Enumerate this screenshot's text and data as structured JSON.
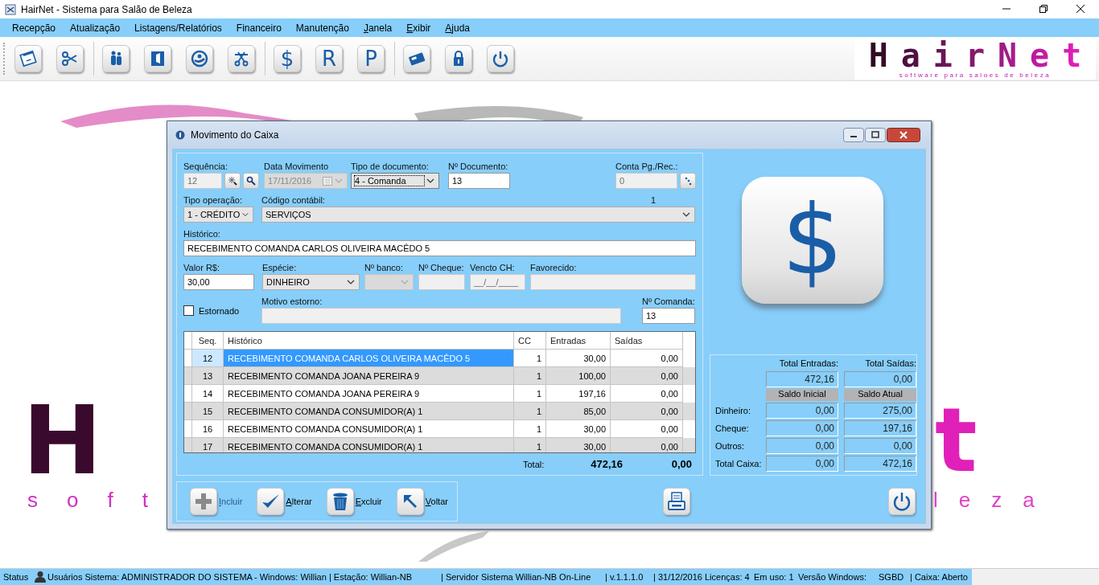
{
  "app": {
    "title": "HairNet - Sistema para Salão de Beleza"
  },
  "menu": [
    {
      "label": "Recepção",
      "mnemonic": false
    },
    {
      "label": "Atualização",
      "mnemonic": false
    },
    {
      "label": "Listagens/Relatórios",
      "mnemonic": false
    },
    {
      "label": "Financeiro",
      "mnemonic": false
    },
    {
      "label": "Manutenção",
      "mnemonic": false
    },
    {
      "label": "Janela",
      "mnemonic": true
    },
    {
      "label": "Exibir",
      "mnemonic": true
    },
    {
      "label": "Ajuda",
      "mnemonic": true
    }
  ],
  "toolbar": [
    [
      {
        "kind": "icon"
      },
      {
        "kind": "icon"
      }
    ],
    [
      {
        "kind": "icon"
      },
      {
        "kind": "icon"
      },
      {
        "kind": "icon"
      },
      {
        "kind": "icon"
      }
    ],
    [
      {
        "kind": "glyph",
        "glyph": "$"
      },
      {
        "kind": "glyph",
        "glyph": "R"
      },
      {
        "kind": "glyph",
        "glyph": "P"
      }
    ],
    [
      {
        "kind": "icon"
      },
      {
        "kind": "icon"
      },
      {
        "kind": "icon"
      }
    ]
  ],
  "logo": {
    "name": "HairNet",
    "tagline": "software para saloes de beleza"
  },
  "background_logo": {
    "letter_left": "H",
    "letter_right": "t",
    "tagline_left": "soft",
    "tagline_right": "leza"
  },
  "dialog": {
    "title": "Movimento do Caixa",
    "rows": [
      [
        {
          "kind": "text",
          "label": "Sequência:",
          "value": "12",
          "disabled": true
        },
        {
          "kind": "date",
          "label": "Data Movimento",
          "value": "17/11/2016",
          "disabled": true
        },
        {
          "kind": "combo",
          "label": "Tipo de documento:",
          "value": "4 - Comanda",
          "disabled": false,
          "focused": true
        },
        {
          "kind": "text",
          "label": "Nº Documento:",
          "value": "13",
          "disabled": false
        },
        {
          "kind": "spacer"
        },
        {
          "kind": "text",
          "label": "Conta Pg./Rec.:",
          "value": "0",
          "disabled": true
        }
      ],
      [
        {
          "kind": "combo",
          "label": "Tipo operação:",
          "value": "1 - CRÉDITO",
          "disabled": false
        },
        {
          "kind": "combo",
          "label": "Código contábil:",
          "value": "SERVIÇOS",
          "disabled": false,
          "note": "1"
        }
      ],
      [
        {
          "kind": "text",
          "label": "Histórico:",
          "value": "RECEBIMENTO COMANDA CARLOS OLIVEIRA MACÊDO 5",
          "disabled": false
        }
      ],
      [
        {
          "kind": "text",
          "label": "Valor R$:",
          "value": "30,00",
          "disabled": false
        },
        {
          "kind": "combo",
          "label": "Espécie:",
          "value": "DINHEIRO",
          "disabled": false
        },
        {
          "kind": "combo",
          "label": "Nº banco:",
          "disabled": true
        },
        {
          "kind": "text",
          "label": "Nº Cheque:",
          "disabled": true
        },
        {
          "kind": "text",
          "label": "Vencto CH:",
          "value": "__/__/____",
          "disabled": true
        },
        {
          "kind": "text",
          "label": "Favorecido:",
          "disabled": true
        }
      ],
      [
        {
          "kind": "checkbox",
          "label": "Estornado",
          "checked": false
        },
        {
          "kind": "text",
          "label": "Motivo estorno:",
          "disabled": true
        },
        {
          "kind": "text",
          "label": "Nº Comanda:",
          "value": "13",
          "disabled": false
        }
      ]
    ],
    "table": {
      "columns": [
        "Seq.",
        "Histórico",
        "CC",
        "Entradas",
        "Saídas"
      ],
      "rows": [
        {
          "cells": [
            "12",
            "RECEBIMENTO COMANDA CARLOS OLIVEIRA MACÊDO 5",
            "1",
            "30,00",
            "0,00"
          ],
          "selected": true
        },
        {
          "cells": [
            "13",
            "RECEBIMENTO COMANDA JOANA PEREIRA 9",
            "1",
            "100,00",
            "0,00"
          ],
          "selected": false
        },
        {
          "cells": [
            "14",
            "RECEBIMENTO COMANDA JOANA PEREIRA 9",
            "1",
            "197,16",
            "0,00"
          ],
          "selected": false
        },
        {
          "cells": [
            "15",
            "RECEBIMENTO COMANDA CONSUMIDOR(A) 1",
            "1",
            "85,00",
            "0,00"
          ],
          "selected": false
        },
        {
          "cells": [
            "16",
            "RECEBIMENTO COMANDA CONSUMIDOR(A) 1",
            "1",
            "30,00",
            "0,00"
          ],
          "selected": false
        },
        {
          "cells": [
            "17",
            "RECEBIMENTO COMANDA CONSUMIDOR(A) 1",
            "1",
            "30,00",
            "0,00"
          ],
          "selected": false
        }
      ],
      "totals": {
        "label": "Total:",
        "entradas": "472,16",
        "saidas": "0,00"
      }
    },
    "big_icon_glyph": "$",
    "summary": {
      "totals": [
        {
          "label": "Total Entradas:",
          "value": "472,16"
        },
        {
          "label": "Total Saídas:",
          "value": "0,00"
        }
      ],
      "columns": [
        "Saldo Inicial",
        "Saldo Atual"
      ],
      "rows": [
        {
          "label": "Dinheiro:",
          "values": [
            "0,00",
            "275,00"
          ]
        },
        {
          "label": "Cheque:",
          "values": [
            "0,00",
            "197,16"
          ]
        },
        {
          "label": "Outros:",
          "values": [
            "0,00",
            "0,00"
          ]
        },
        {
          "label": "Total Caixa:",
          "values": [
            "0,00",
            "472,16"
          ]
        }
      ]
    },
    "actions": [
      {
        "label": "Incluir",
        "disabled": true
      },
      {
        "label": "Alterar",
        "disabled": false
      },
      {
        "label": "Excluir",
        "disabled": false
      },
      {
        "label": "Voltar",
        "disabled": false
      }
    ]
  },
  "status_bar": [
    "Status",
    "Usuários Sistema: ADMINISTRADOR DO SISTEMA",
    "- Windows: Willian | Estação: Willian-NB",
    "| Servidor Sistema Willian-NB On-Line",
    "| v.1.1.1.0",
    "| 31/12/2016",
    "Licenças: 4",
    "Em uso: 1",
    "Versão Windows:",
    "SGBD",
    "| Caixa: Aberto"
  ]
}
